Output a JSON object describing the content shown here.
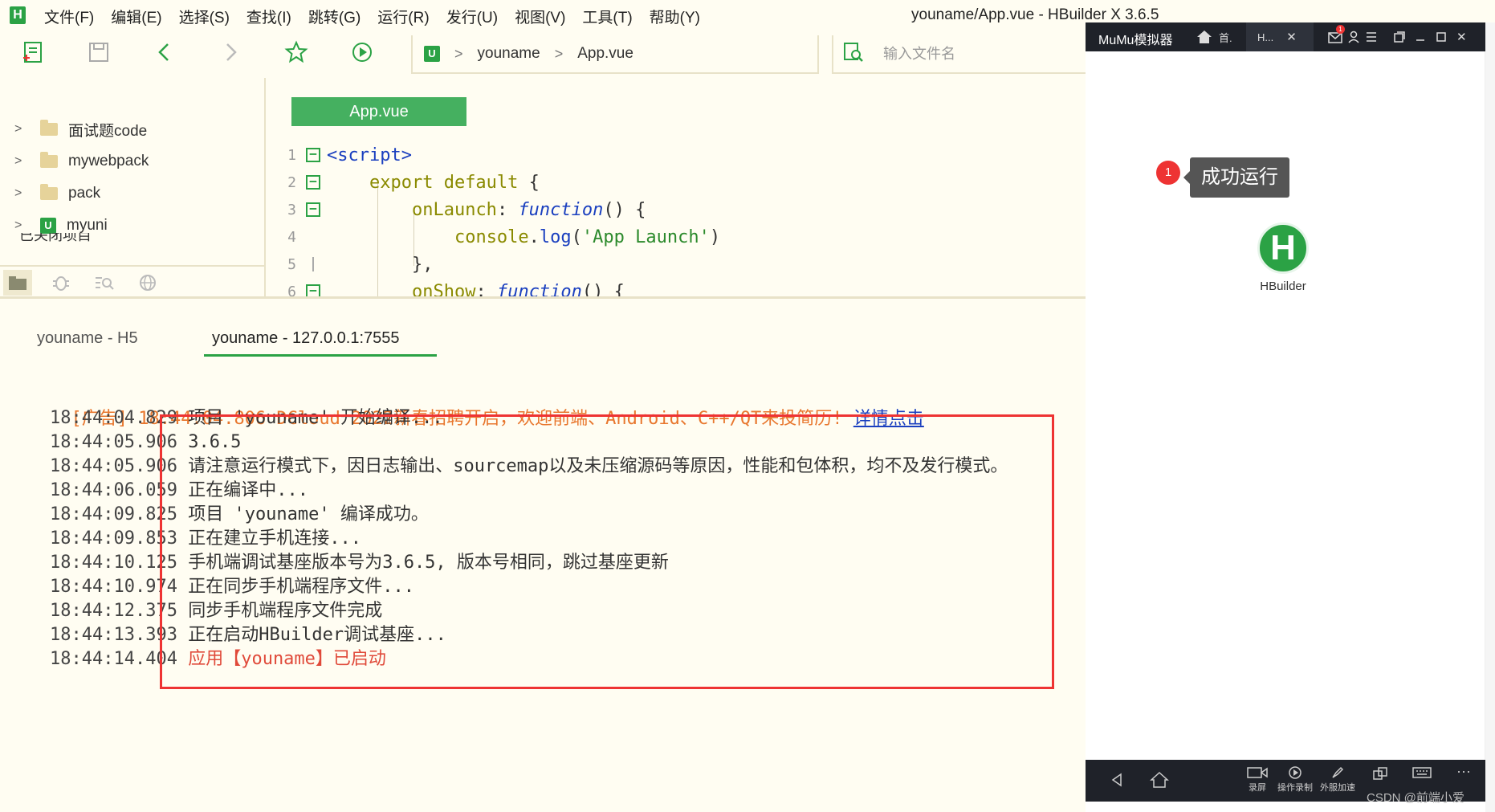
{
  "app": {
    "logo": "H",
    "window_title": "youname/App.vue - HBuilder X 3.6.5"
  },
  "menu": [
    "文件(F)",
    "编辑(E)",
    "选择(S)",
    "查找(I)",
    "跳转(G)",
    "运行(R)",
    "发行(U)",
    "视图(V)",
    "工具(T)",
    "帮助(Y)"
  ],
  "toolbar": {
    "icons": [
      "new-file-icon",
      "save-icon",
      "back-icon",
      "forward-icon",
      "favorite-star-icon",
      "run-icon"
    ],
    "breadcrumb": [
      "youname",
      "App.vue"
    ],
    "file_search_placeholder": "输入文件名"
  },
  "sidebar": {
    "items": [
      {
        "label": "面试题code",
        "type": "folder"
      },
      {
        "label": "mywebpack",
        "type": "folder"
      },
      {
        "label": "pack",
        "type": "folder"
      },
      {
        "label": "myuni",
        "type": "uni-project"
      }
    ],
    "closed_projects": "已关闭项目",
    "tabs": [
      "project-icon",
      "debug-icon",
      "search-icon",
      "browser-icon"
    ]
  },
  "editor": {
    "tab": "App.vue",
    "lines": [
      {
        "n": "1",
        "fold": "open",
        "text": "<script>"
      },
      {
        "n": "2",
        "fold": "open",
        "text": "    export default {"
      },
      {
        "n": "3",
        "fold": "open",
        "text": "        onLaunch: function() {"
      },
      {
        "n": "4",
        "fold": "none",
        "text": "            console.log('App Launch')"
      },
      {
        "n": "5",
        "fold": "end",
        "text": "        },"
      },
      {
        "n": "6",
        "fold": "open",
        "text": "        onShow: function() {"
      }
    ]
  },
  "console": {
    "tabs": [
      "youname - H5",
      "youname - 127.0.0.1:7555"
    ],
    "active_tab": 1,
    "ad": {
      "prefix": "[广告] 18:44:04.806 DCloud 2022新春招聘开启，欢迎前端、Android、C++/QT来投简历!",
      "link": "详情点击"
    },
    "logs": [
      {
        "ts": "18:44:04.829",
        "msg": "项目 'youname' 开始编译...",
        "color": "normal"
      },
      {
        "ts": "18:44:05.906",
        "msg": "3.6.5",
        "color": "normal"
      },
      {
        "ts": "18:44:05.906",
        "msg": "请注意运行模式下，因日志输出、sourcemap以及未压缩源码等原因，性能和包体积，均不及发行模式。",
        "color": "normal"
      },
      {
        "ts": "18:44:06.059",
        "msg": "正在编译中...",
        "color": "normal"
      },
      {
        "ts": "18:44:09.825",
        "msg": "项目 'youname' 编译成功。",
        "color": "normal"
      },
      {
        "ts": "18:44:09.853",
        "msg": "正在建立手机连接...",
        "color": "normal"
      },
      {
        "ts": "18:44:10.125",
        "msg": "手机端调试基座版本号为3.6.5, 版本号相同，跳过基座更新",
        "color": "normal"
      },
      {
        "ts": "18:44:10.974",
        "msg": "正在同步手机端程序文件...",
        "color": "normal"
      },
      {
        "ts": "18:44:12.375",
        "msg": "同步手机端程序文件完成",
        "color": "normal"
      },
      {
        "ts": "18:44:13.393",
        "msg": "正在启动HBuilder调试基座...",
        "color": "normal"
      },
      {
        "ts": "18:44:14.404",
        "msg": "应用【youname】已启动",
        "color": "red"
      }
    ]
  },
  "emulator": {
    "title": "MuMu模拟器",
    "tabs": [
      "首.",
      "H..."
    ],
    "notification_count": "1",
    "toast_number": "1",
    "toast_text": "成功运行",
    "app_icon_letter": "H",
    "app_label": "HBuilder",
    "bottom_buttons": [
      "录屏",
      "操作录制",
      "外服加速",
      "",
      ""
    ],
    "watermark": "CSDN @前端小爱"
  },
  "colors": {
    "accent_green": "#2ba245",
    "highlight_red": "#e33333",
    "background": "#fffdf2",
    "emulator_bar": "#1f2229"
  }
}
